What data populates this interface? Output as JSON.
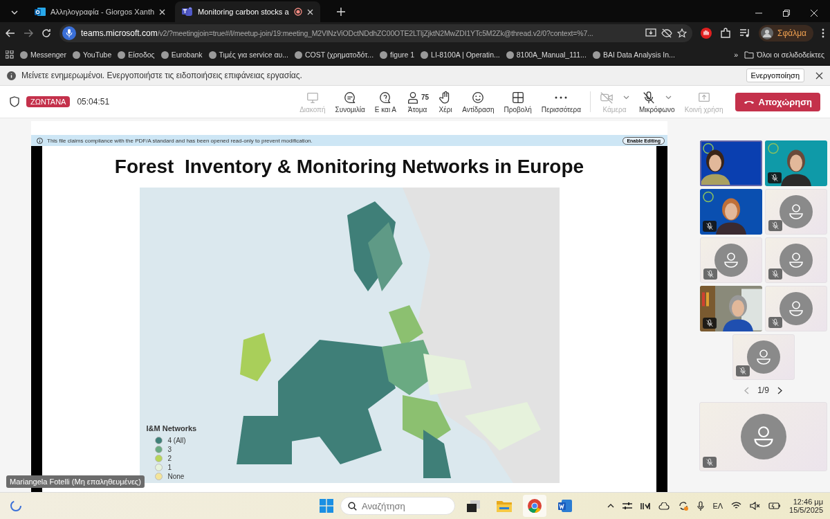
{
  "browser": {
    "tabs": [
      {
        "title": "Αλληλογραφία - Giorgos Xanth",
        "kind": "mail",
        "recording": false,
        "selected": false
      },
      {
        "title": "Monitoring carbon stocks a",
        "kind": "teams",
        "recording": true,
        "selected": true
      }
    ],
    "address": {
      "host": "teams.microsoft.com",
      "path": "/v2/?meetingjoin=true#/l/meetup-join/19:meeting_M2VlNzViODctNDdhZC00OTE2LTljZjktN2MwZDI1YTc5M2Zk@thread.v2/0?context=%7..."
    },
    "profile": "Σφάλμα",
    "bookmarks": [
      {
        "label": "Messenger"
      },
      {
        "label": "YouTube"
      },
      {
        "label": "Είσοδος"
      },
      {
        "label": "Eurobank"
      },
      {
        "label": "Τιμές για service αυ..."
      },
      {
        "label": "COST (χρηματοδότ..."
      },
      {
        "label": "figure 1"
      },
      {
        "label": "LI-8100A | Operatin..."
      },
      {
        "label": "8100A_Manual_111..."
      },
      {
        "label": "BAI Data Analysis In..."
      }
    ],
    "more_bookmarks": "»",
    "all_bookmarks": "Όλοι οι σελιδοδείκτες"
  },
  "notification": {
    "text": "Μείνετε ενημερωμένοι. Ενεργοποιήστε τις ειδοποιήσεις επιφάνειας εργασίας.",
    "button": "Ενεργοποίηση"
  },
  "meeting_bar": {
    "live_badge": "ΖΩΝΤΑΝΑ",
    "timer": "05:04:51",
    "tools": [
      {
        "label": "Διακοπή",
        "kind": "screen",
        "disabled": true
      },
      {
        "label": "Συνομιλία",
        "kind": "chat",
        "disabled": false
      },
      {
        "label": "Ε και Α",
        "kind": "qa",
        "disabled": false
      },
      {
        "label": "Άτομα",
        "kind": "people",
        "count": "75",
        "disabled": false
      },
      {
        "label": "Χέρι",
        "kind": "hand",
        "disabled": false
      },
      {
        "label": "Αντίδραση",
        "kind": "smile",
        "disabled": false
      },
      {
        "label": "Προβολή",
        "kind": "grid",
        "disabled": false
      },
      {
        "label": "Περισσότερα",
        "kind": "more",
        "disabled": false
      }
    ],
    "devices": [
      {
        "label": "Κάμερα",
        "kind": "camera",
        "disabled": true,
        "caret": true
      },
      {
        "label": "Μικρόφωνο",
        "kind": "mic",
        "disabled": false,
        "caret": true
      },
      {
        "label": "Κοινή χρήση",
        "kind": "share",
        "disabled": true,
        "caret": false
      }
    ],
    "leave_button": "Αποχώρηση"
  },
  "slide": {
    "pdf_notice": "This file claims compliance with the PDF/A standard and has been opened read-only to prevent modification.",
    "enable_editing": "Enable Editing",
    "title": "Forest  Inventory & Monitoring Networks in Europe",
    "legend": {
      "title": "I&M Networks",
      "items": [
        {
          "label": "4 (All)",
          "color": "#3f7f78"
        },
        {
          "label": "3",
          "color": "#6aaa82"
        },
        {
          "label": "2",
          "color": "#b8d65a"
        },
        {
          "label": "1",
          "color": "#e6f2dc"
        },
        {
          "label": "None",
          "color": "#f3e49a"
        }
      ]
    }
  },
  "presenter_label": "Mariangela Fotelli (Μη επαληθευμένες)",
  "participants": [
    {
      "kind": "video",
      "muted": false,
      "speaking": true
    },
    {
      "kind": "video",
      "muted": true,
      "speaking": false
    },
    {
      "kind": "video",
      "muted": true,
      "speaking": false
    },
    {
      "kind": "avatar",
      "muted": true,
      "speaking": false
    },
    {
      "kind": "avatar",
      "muted": true,
      "speaking": false
    },
    {
      "kind": "avatar",
      "muted": true,
      "speaking": false
    },
    {
      "kind": "video",
      "muted": true,
      "speaking": false
    },
    {
      "kind": "avatar",
      "muted": true,
      "speaking": false
    },
    {
      "kind": "avatar",
      "muted": true,
      "speaking": false
    }
  ],
  "pager": "1/9",
  "self_tile": {
    "kind": "avatar",
    "muted": true
  },
  "taskbar": {
    "search_placeholder": "Αναζήτηση",
    "apps": [
      {
        "kind": "taskview",
        "selected": false
      },
      {
        "kind": "files",
        "selected": false
      },
      {
        "kind": "chrome",
        "selected": true
      },
      {
        "kind": "word",
        "selected": false
      }
    ],
    "language": "ΕΛ",
    "time": "12:46 μμ",
    "date": "15/5/2025"
  }
}
